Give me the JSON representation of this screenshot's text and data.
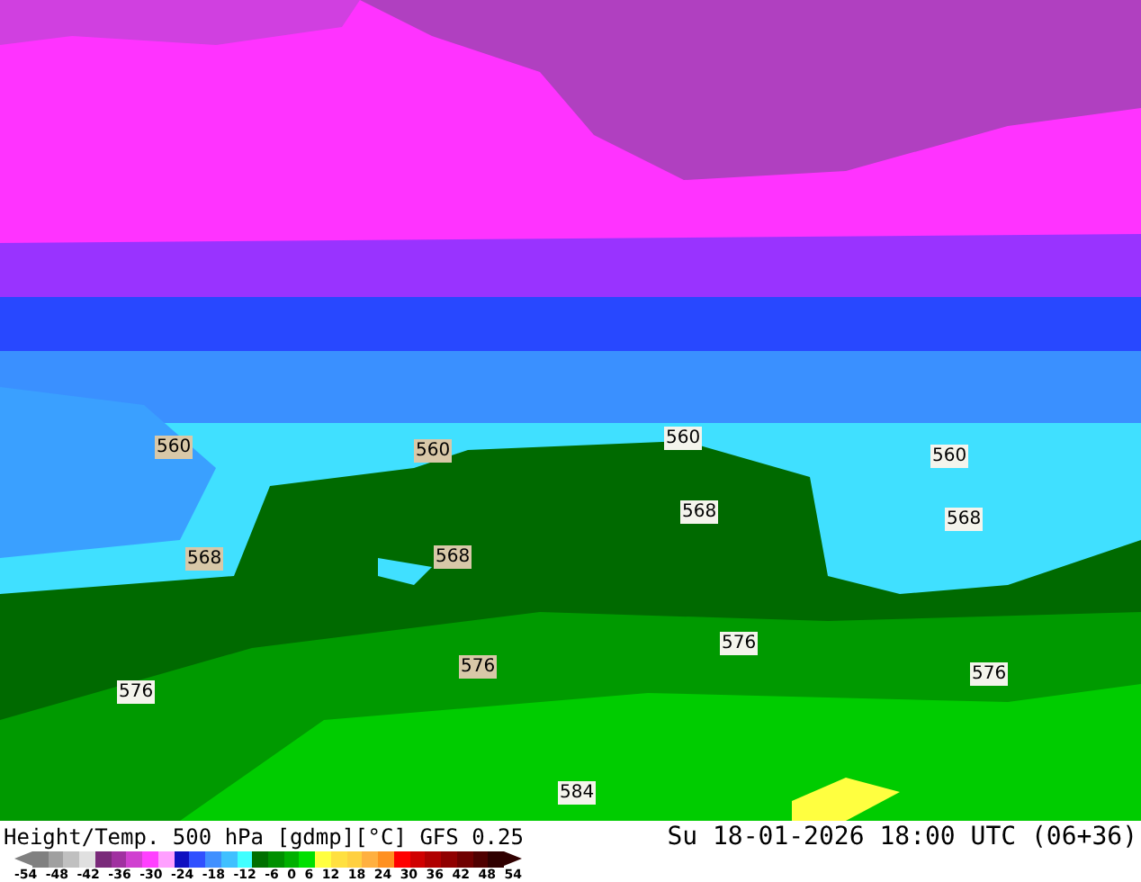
{
  "map": {
    "contour_labels": [
      {
        "text": "560",
        "selected": false
      },
      {
        "text": "560",
        "selected": false
      },
      {
        "text": "560",
        "selected": true
      },
      {
        "text": "560",
        "selected": true
      },
      {
        "text": "568",
        "selected": false
      },
      {
        "text": "568",
        "selected": false
      },
      {
        "text": "568",
        "selected": true
      },
      {
        "text": "568",
        "selected": true
      },
      {
        "text": "576",
        "selected": true
      },
      {
        "text": "576",
        "selected": false
      },
      {
        "text": "576",
        "selected": true
      },
      {
        "text": "576",
        "selected": true
      },
      {
        "text": "584",
        "selected": true
      }
    ]
  },
  "footer": {
    "title": "Height/Temp. 500 hPa [gdmp][°C] GFS 0.25",
    "valid_time": "Su 18-01-2026 18:00 UTC (06+36)"
  },
  "color_scale": {
    "swatches": [
      {
        "color": "#808080"
      },
      {
        "color": "#a0a0a0"
      },
      {
        "color": "#c0c0c0"
      },
      {
        "color": "#e0e0e0"
      },
      {
        "color": "#7a2a7a"
      },
      {
        "color": "#a030a0"
      },
      {
        "color": "#d040d0"
      },
      {
        "color": "#ff40ff"
      },
      {
        "color": "#ffa0ff"
      },
      {
        "color": "#1010c0"
      },
      {
        "color": "#3050ff"
      },
      {
        "color": "#4090ff"
      },
      {
        "color": "#40c0ff"
      },
      {
        "color": "#40ffff"
      },
      {
        "color": "#007000"
      },
      {
        "color": "#009000"
      },
      {
        "color": "#00b000"
      },
      {
        "color": "#00e000"
      },
      {
        "color": "#ffff40"
      },
      {
        "color": "#ffe040"
      },
      {
        "color": "#ffd040"
      },
      {
        "color": "#ffb040"
      },
      {
        "color": "#ff9020"
      },
      {
        "color": "#ff0000"
      },
      {
        "color": "#d00000"
      },
      {
        "color": "#b00000"
      },
      {
        "color": "#900000"
      },
      {
        "color": "#700000"
      },
      {
        "color": "#500000"
      },
      {
        "color": "#300000"
      }
    ],
    "labels": [
      "-54",
      "-48",
      "-42",
      "-36",
      "-30",
      "-24",
      "-18",
      "-12",
      "-6",
      "0",
      "6",
      "12",
      "18",
      "24",
      "30",
      "36",
      "42",
      "48",
      "54"
    ]
  }
}
